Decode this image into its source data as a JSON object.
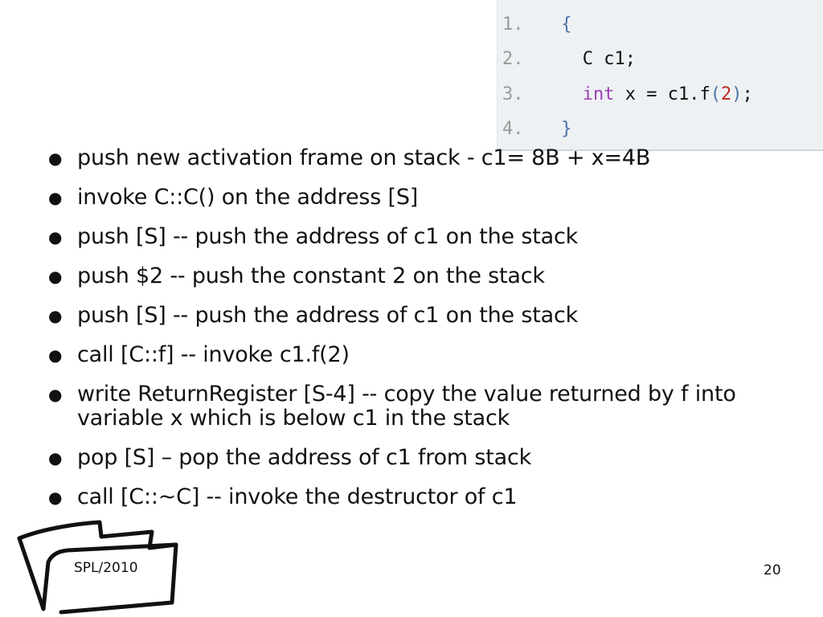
{
  "code": {
    "lines": [
      {
        "num": "1.",
        "indent": " ",
        "parts": {
          "brace": "{"
        }
      },
      {
        "num": "2.",
        "indent": "   ",
        "text": "C c1;"
      },
      {
        "num": "3.",
        "indent": "   ",
        "kw": "int",
        "mid": " x = c1.f",
        "open": "(",
        "arg": "2",
        "close": ")",
        "end": ";"
      },
      {
        "num": "4.",
        "indent": " ",
        "parts": {
          "brace": "}"
        }
      }
    ]
  },
  "bullets": [
    "push new activation frame on stack - c1= 8B + x=4B",
    "invoke C::C() on the address [S]",
    "push [S] -- push the address of c1 on the stack",
    "push $2 -- push the constant 2 on the stack",
    "push [S] -- push the address of c1 on the stack",
    "call [C::f] -- invoke c1.f(2)",
    "write ReturnRegister [S-4] -- copy the value returned by f into variable x which is below c1 in the stack",
    "pop [S] – pop the address of c1 from stack",
    "call [C::~C] -- invoke the destructor of c1"
  ],
  "bullet_glyph": "●",
  "footer": {
    "folder_label": "SPL/2010",
    "page_number": "20"
  }
}
